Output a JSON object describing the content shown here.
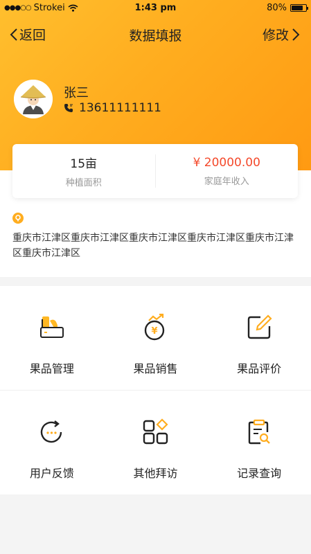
{
  "status_bar": {
    "carrier": "Strokei",
    "time": "1:43 pm",
    "battery": "80%"
  },
  "nav": {
    "back_label": "返回",
    "title": "数据填报",
    "edit_label": "修改"
  },
  "profile": {
    "name": "张三",
    "phone": "13611111111"
  },
  "stats": {
    "area_value": "15亩",
    "area_label": "种植面积",
    "income_value": "¥ 20000.00",
    "income_label": "家庭年收入"
  },
  "address": {
    "text": "重庆市江津区重庆市江津区重庆市江津区重庆市江津区重庆市江津区重庆市江津区"
  },
  "grid": {
    "items": [
      {
        "label": "果品管理",
        "icon": "fruit-management-icon"
      },
      {
        "label": "果品销售",
        "icon": "fruit-sales-icon"
      },
      {
        "label": "果品评价",
        "icon": "fruit-review-icon"
      },
      {
        "label": "用户反馈",
        "icon": "user-feedback-icon"
      },
      {
        "label": "其他拜访",
        "icon": "other-visits-icon"
      },
      {
        "label": "记录查询",
        "icon": "record-query-icon"
      }
    ]
  },
  "colors": {
    "primary": "#ffad1f",
    "accent_red": "#f4492b"
  }
}
